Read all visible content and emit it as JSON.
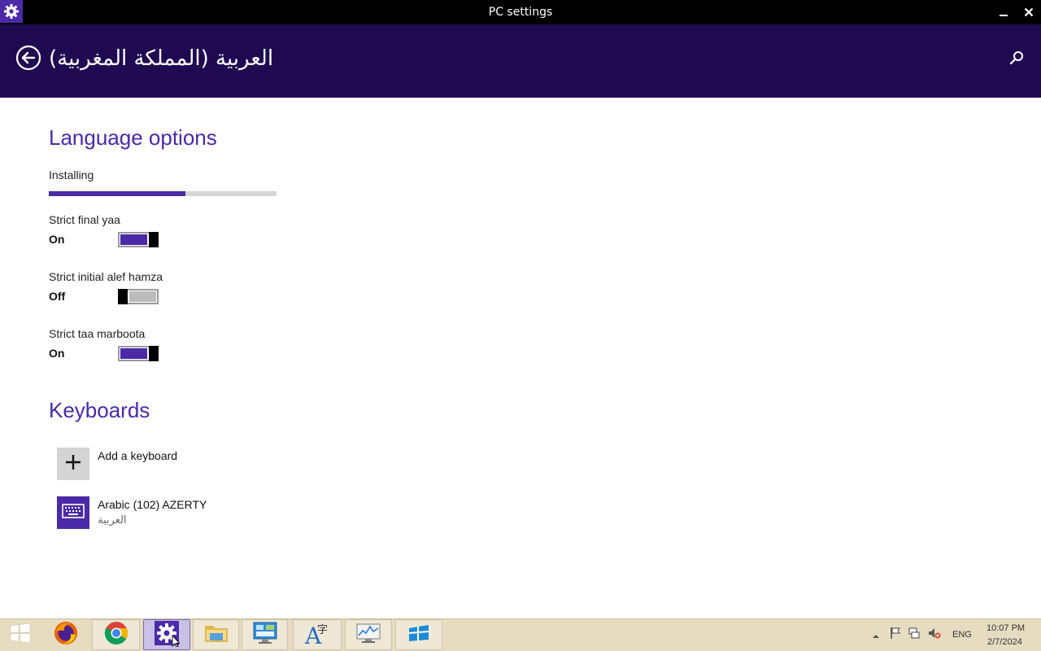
{
  "window": {
    "title": "PC settings",
    "app_icon": "gear-icon",
    "controls": [
      "minimize-icon",
      "close-icon"
    ]
  },
  "header": {
    "title": "العربية (المملكة المغربية)",
    "back_icon": "back-arrow-icon",
    "search_icon": "search-icon"
  },
  "language_options": {
    "title": "Language options",
    "status": "Installing",
    "progress": 0.6,
    "options": [
      {
        "label": "Strict final yaa",
        "state": "On"
      },
      {
        "label": "Strict initial alef hamza",
        "state": "Off"
      },
      {
        "label": "Strict taa marboota",
        "state": "On"
      }
    ]
  },
  "keyboards": {
    "title": "Keyboards",
    "add_label": "Add a keyboard",
    "items": [
      {
        "name": "Arabic (102) AZERTY",
        "sub": "العربية"
      }
    ]
  },
  "taskbar": {
    "apps": [
      "windows-start",
      "firefox",
      "chrome",
      "pc-settings",
      "file-explorer",
      "control-panel",
      "language-tool",
      "performance-monitor",
      "app-tile"
    ],
    "tray": {
      "language": "ENG",
      "time": "10:07 PM",
      "date": "2/7/2024"
    }
  },
  "colors": {
    "accent": "#4a2aa6",
    "header_bg": "#1f0a52",
    "titlebar_bg": "#000000",
    "taskbar_bg": "#e6dcc0"
  }
}
